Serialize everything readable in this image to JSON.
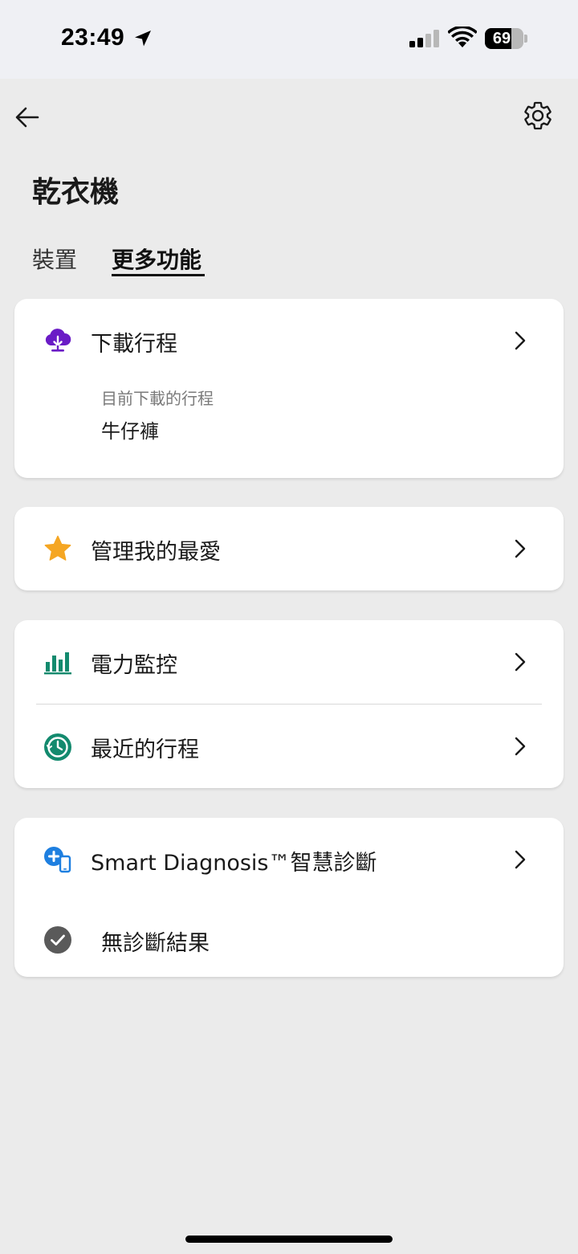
{
  "status_bar": {
    "time": "23:49",
    "battery": "69",
    "battery_level": 0.69
  },
  "header": {
    "title": "乾衣機",
    "back_icon": "arrow-left-icon",
    "settings_icon": "gear-icon"
  },
  "tabs": [
    {
      "label": "裝置",
      "active": false
    },
    {
      "label": "更多功能",
      "active": true
    }
  ],
  "cards": {
    "download": {
      "label": "下載行程",
      "icon": "cloud-download-icon",
      "sub_label": "目前下載的行程",
      "sub_value": "牛仔褲"
    },
    "favorite": {
      "label": "管理我的最愛",
      "icon": "star-icon"
    },
    "power": {
      "label": "電力監控",
      "icon": "bar-chart-icon"
    },
    "recent": {
      "label": "最近的行程",
      "icon": "history-clock-icon"
    },
    "diagnosis": {
      "label": "Smart Diagnosis™智慧診斷",
      "icon": "smart-diagnosis-icon",
      "result_label": "無診斷結果",
      "result_icon": "check-circle-icon"
    }
  },
  "colors": {
    "background": "#ebebeb",
    "card": "#ffffff",
    "download_icon": "#6a1bc6",
    "star_icon": "#f5a623",
    "power_icon": "#138a6e",
    "recent_icon": "#138a6e",
    "diagnosis_icon": "#1e7fe0",
    "check_icon": "#5a5a5a"
  }
}
